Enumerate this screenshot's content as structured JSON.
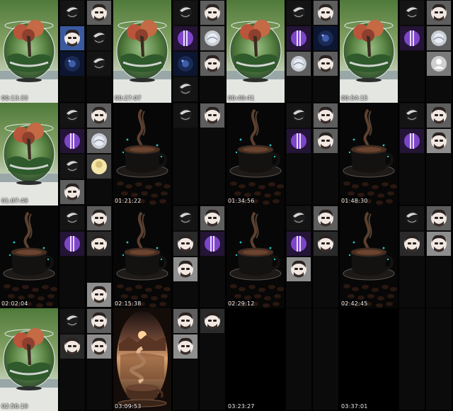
{
  "palette": {
    "tile_dark": "#141414",
    "tile_gray": "#5e5e5e",
    "tile_purple": "#7d46c8",
    "tile_blue": "#0c1630",
    "tile_light": "#8e8e8e",
    "slot_empty": "#0b0b0b",
    "timestamp": "#f2f2f2"
  },
  "frames": [
    {
      "timestamp": "00:13:33",
      "thumbnail": "terrarium-glass",
      "tiles": [
        "avatar-dark",
        "face-gray",
        "face-blue",
        "avatar-dark",
        "avatar-blue",
        "avatar-dark"
      ]
    },
    {
      "timestamp": "00:27:07",
      "thumbnail": "terrarium-glass",
      "tiles": [
        "avatar-dark",
        "face-gray",
        "purple",
        "avatar-gray",
        "avatar-blue",
        "face-gray",
        "avatar-dark"
      ]
    },
    {
      "timestamp": "00:40:41",
      "thumbnail": "terrarium-glass",
      "tiles": [
        "avatar-dark",
        "face-gray",
        "purple",
        "avatar-blue",
        "avatar-gray",
        "face-gray"
      ]
    },
    {
      "timestamp": "00:54:15",
      "thumbnail": "terrarium-glass",
      "tiles": [
        "avatar-dark",
        "face-gray",
        "purple",
        "avatar-gray",
        "empty",
        "avatar-placeholder"
      ]
    },
    {
      "timestamp": "01:07:49",
      "thumbnail": "terrarium-glass",
      "tiles": [
        "avatar-dark",
        "face-gray",
        "purple",
        "avatar-gray",
        "avatar-dark",
        "avatar-light",
        "face-gray"
      ]
    },
    {
      "timestamp": "01:21:22",
      "thumbnail": "coffee-cup",
      "tiles": [
        "avatar-dark",
        "face-gray"
      ]
    },
    {
      "timestamp": "01:34:56",
      "thumbnail": "coffee-cup",
      "tiles": [
        "avatar-dark",
        "face-gray",
        "purple",
        "face-gray"
      ]
    },
    {
      "timestamp": "01:48:30",
      "thumbnail": "coffee-cup",
      "tiles": [
        "avatar-dark",
        "face-gray",
        "purple",
        "face-light"
      ]
    },
    {
      "timestamp": "02:02:04",
      "thumbnail": "coffee-cup",
      "tiles": [
        "avatar-dark",
        "face-gray",
        "purple",
        "face-dark",
        "empty",
        "empty",
        "empty",
        "face-light"
      ]
    },
    {
      "timestamp": "02:15:38",
      "thumbnail": "coffee-cup",
      "tiles": [
        "avatar-dark",
        "face-gray",
        "face-dark",
        "purple",
        "face-light"
      ]
    },
    {
      "timestamp": "02:29:12",
      "thumbnail": "coffee-cup",
      "tiles": [
        "avatar-dark",
        "face-gray",
        "purple",
        "face-dark",
        "face-light"
      ]
    },
    {
      "timestamp": "02:42:45",
      "thumbnail": "coffee-cup",
      "tiles": [
        "avatar-dark",
        "face-gray",
        "face-dark",
        "face-light"
      ]
    },
    {
      "timestamp": "02:56:19",
      "thumbnail": "terrarium-glass",
      "tiles": [
        "avatar-dark",
        "face-gray",
        "face-dark",
        "face-light"
      ]
    },
    {
      "timestamp": "03:09:53",
      "thumbnail": "coffee-landscape",
      "tiles": [
        "face-gray",
        "face-dark",
        "face-light"
      ]
    },
    {
      "timestamp": "03:23:27",
      "thumbnail": "none",
      "tiles": []
    },
    {
      "timestamp": "03:37:01",
      "thumbnail": "none",
      "tiles": []
    }
  ]
}
